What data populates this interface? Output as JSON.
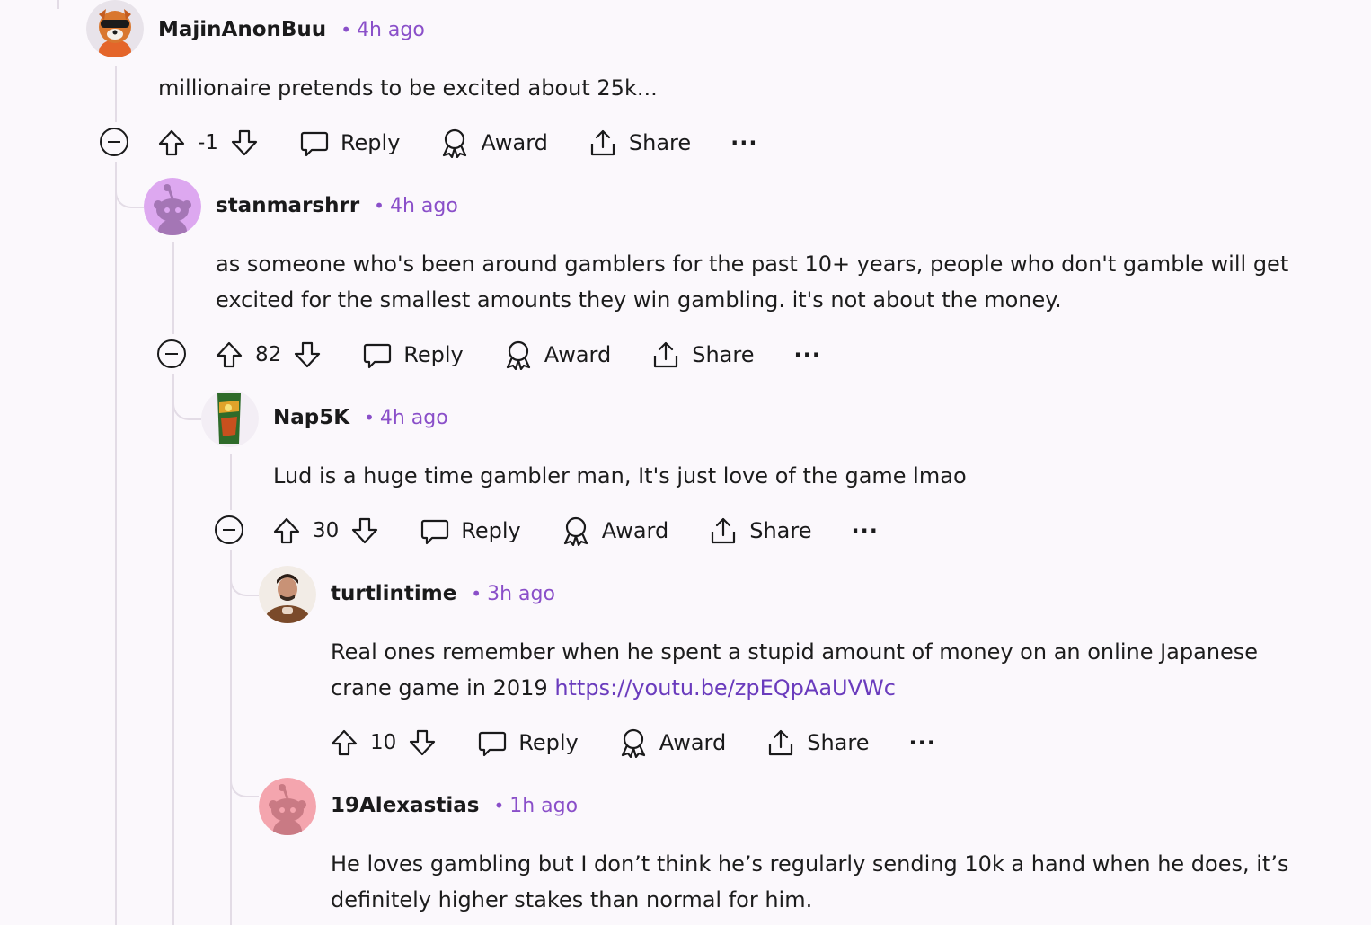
{
  "colors": {
    "background": "#fbf8fc",
    "accent": "#8a4fc9",
    "link": "#6a3bbd",
    "thread_line": "#e3dce6"
  },
  "actions": {
    "reply": "Reply",
    "award": "Award",
    "share": "Share",
    "more": "···"
  },
  "comments": [
    {
      "username": "MajinAnonBuu",
      "dot": "•",
      "time": "4h ago",
      "lines": [
        "millionaire pretends to be excited about 25k..."
      ],
      "score": "-1",
      "avatar_icon": "snoo-red-panda-avatar"
    },
    {
      "username": "stanmarshrr",
      "dot": "•",
      "time": "4h ago",
      "lines": [
        "as someone who's been around gamblers for the past 10+ years, people who don't gamble will get",
        "excited for the smallest amounts they win gambling. it's not about the money."
      ],
      "score": "82",
      "avatar_icon": "snoo-default-purple-avatar"
    },
    {
      "username": "Nap5K",
      "dot": "•",
      "time": "4h ago",
      "lines": [
        "Lud is a huge time gambler man, It's just love of the game lmao"
      ],
      "score": "30",
      "avatar_icon": "snack-bag-avatar"
    },
    {
      "username": "turtlintime",
      "dot": "•",
      "time": "3h ago",
      "lines": [
        "Real ones remember when he spent a stupid amount of money on an online Japanese",
        "crane game in 2019 "
      ],
      "link": "https://youtu.be/zpEQpAaUVWc",
      "score": "10",
      "avatar_icon": "person-photo-avatar"
    },
    {
      "username": "19Alexastias",
      "dot": "•",
      "time": "1h ago",
      "lines": [
        "He loves gambling but I don’t think he’s regularly sending 10k a hand when he does, it’s",
        "definitely higher stakes than normal for him."
      ],
      "avatar_icon": "snoo-default-pink-avatar"
    }
  ]
}
